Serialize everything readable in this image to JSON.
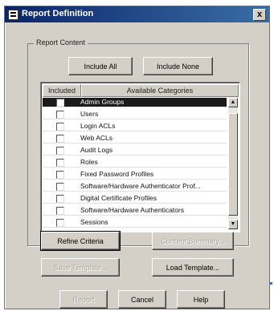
{
  "window": {
    "title": "Report Definition",
    "close_label": "x"
  },
  "group": {
    "label": "Report Content",
    "include_all": "Include All",
    "include_none": "Include None"
  },
  "table": {
    "headers": [
      "Included",
      "Available Categories"
    ],
    "rows": [
      {
        "label": "Admin Groups",
        "selected": true
      },
      {
        "label": "Users"
      },
      {
        "label": "Login ACLs"
      },
      {
        "label": "Web ACLs"
      },
      {
        "label": "Audit Logs"
      },
      {
        "label": "Roles"
      },
      {
        "label": "Fixed Password Profiles"
      },
      {
        "label": "Software/Hardware Authenticator Prof..."
      },
      {
        "label": "Digital Certificate Profiles"
      },
      {
        "label": "Software/Hardware Authenticators"
      },
      {
        "label": "Sessions"
      }
    ]
  },
  "buttons": {
    "refine": "Refine Criteria",
    "content_summary": "Content Summary...",
    "save_template": "Save Template...",
    "load_template": "Load Template...",
    "report": "Report",
    "cancel": "Cancel",
    "help": "Help"
  }
}
